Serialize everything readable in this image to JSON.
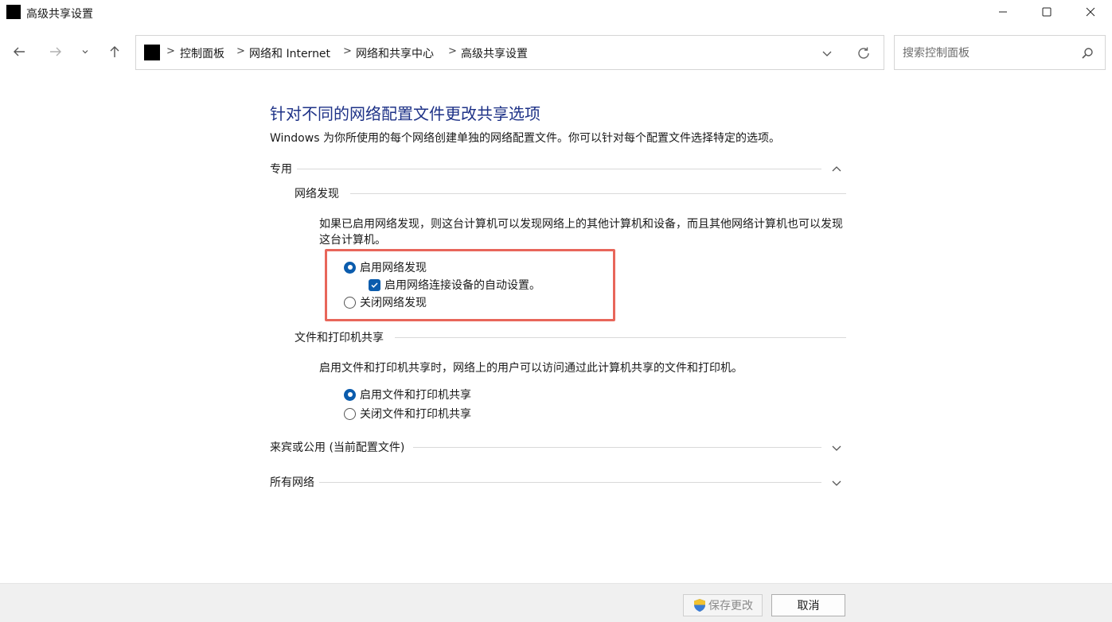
{
  "window": {
    "title": "高级共享设置"
  },
  "address_bar": {
    "breadcrumbs": [
      "控制面板",
      "网络和 Internet",
      "网络和共享中心",
      "高级共享设置"
    ],
    "separator": ">"
  },
  "search": {
    "placeholder": "搜索控制面板"
  },
  "content": {
    "title": "针对不同的网络配置文件更改共享选项",
    "description": "Windows 为你所使用的每个网络创建单独的网络配置文件。你可以针对每个配置文件选择特定的选项。",
    "sections": [
      {
        "label": "专用",
        "expanded": true,
        "subsections": [
          {
            "label": "网络发现",
            "description": "如果已启用网络发现，则这台计算机可以发现网络上的其他计算机和设备，而且其他网络计算机也可以发现这台计算机。",
            "options": [
              {
                "label": "启用网络发现",
                "type": "radio",
                "checked": true
              },
              {
                "label": "启用网络连接设备的自动设置。",
                "type": "checkbox",
                "checked": true
              },
              {
                "label": "关闭网络发现",
                "type": "radio",
                "checked": false
              }
            ]
          },
          {
            "label": "文件和打印机共享",
            "description": "启用文件和打印机共享时，网络上的用户可以访问通过此计算机共享的文件和打印机。",
            "options": [
              {
                "label": "启用文件和打印机共享",
                "type": "radio",
                "checked": true
              },
              {
                "label": "关闭文件和打印机共享",
                "type": "radio",
                "checked": false
              }
            ]
          }
        ]
      },
      {
        "label": "来宾或公用 (当前配置文件)",
        "expanded": false
      },
      {
        "label": "所有网络",
        "expanded": false
      }
    ]
  },
  "footer": {
    "save_label": "保存更改",
    "cancel_label": "取消"
  },
  "colors": {
    "accent": "#0b5cad",
    "title_blue": "#1e3287",
    "highlight": "#e8665a"
  }
}
